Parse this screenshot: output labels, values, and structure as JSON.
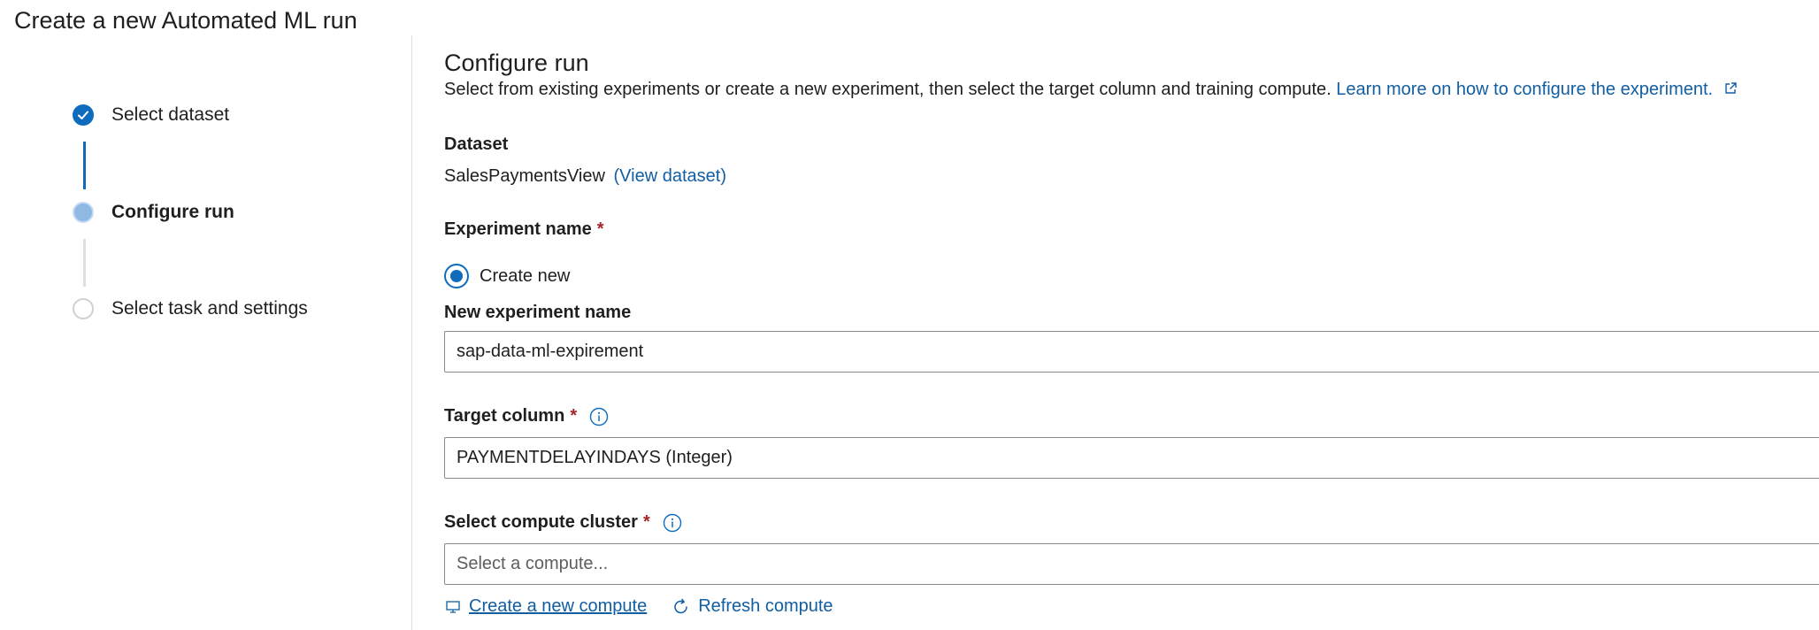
{
  "page": {
    "title": "Create a new Automated ML run"
  },
  "steps": [
    {
      "label": "Select dataset",
      "state": "done"
    },
    {
      "label": "Configure run",
      "state": "current"
    },
    {
      "label": "Select task and settings",
      "state": "pending"
    }
  ],
  "main": {
    "title": "Configure run",
    "description": "Select from existing experiments or create a new experiment, then select the target column and training compute.",
    "learn_more_link": "Learn more on how to configure the experiment.",
    "dataset": {
      "label": "Dataset",
      "value": "SalesPaymentsView",
      "view_link": "(View dataset)"
    },
    "experiment": {
      "label": "Experiment name",
      "required_mark": "*",
      "create_new_option": "Create new",
      "create_new_selected": true,
      "new_name_label": "New experiment name",
      "new_name_value": "sap-data-ml-expirement"
    },
    "target_column": {
      "label": "Target column",
      "required_mark": "*",
      "value": "PAYMENTDELAYINDAYS (Integer)"
    },
    "compute": {
      "label": "Select compute cluster",
      "required_mark": "*",
      "placeholder": "Select a compute...",
      "create_link": "Create a new compute",
      "refresh_link": "Refresh compute"
    }
  },
  "colors": {
    "accent": "#0f6cbd",
    "link": "#115ea3",
    "required": "#a4262c"
  }
}
